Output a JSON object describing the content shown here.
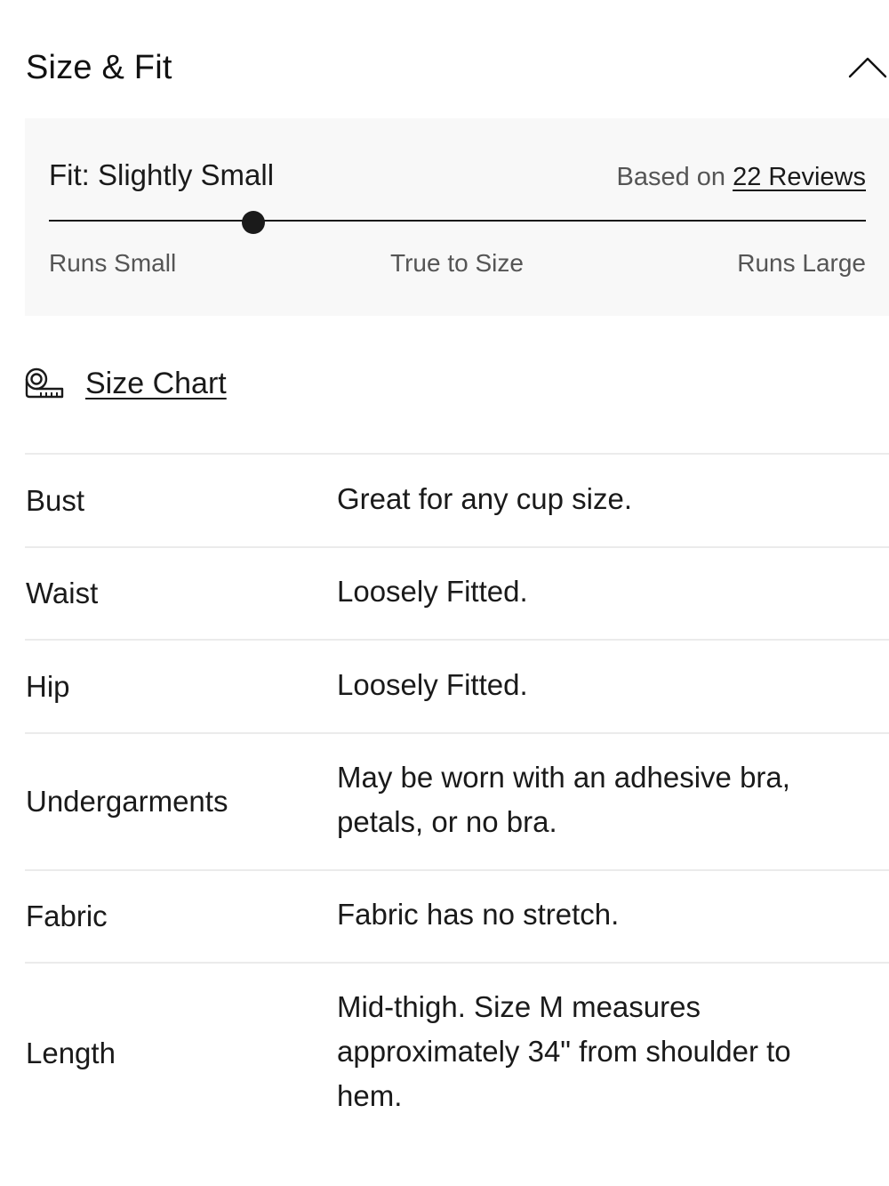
{
  "header": {
    "title": "Size & Fit",
    "collapse_icon": "chevron-up-icon"
  },
  "fit": {
    "label": "Fit: Slightly Small",
    "reviews_prefix": "Based on",
    "reviews_link": "22 Reviews",
    "slider_position": 0.25,
    "scale": {
      "left": "Runs Small",
      "middle": "True to Size",
      "right": "Runs Large"
    }
  },
  "size_chart": {
    "icon": "measuring-tape-icon",
    "label": "Size Chart"
  },
  "specs": [
    {
      "name": "Bust",
      "value": "Great for any cup size."
    },
    {
      "name": "Waist",
      "value": "Loosely Fitted."
    },
    {
      "name": "Hip",
      "value": "Loosely Fitted."
    },
    {
      "name": "Undergarments",
      "value": "May be worn with an adhesive bra, petals, or no bra."
    },
    {
      "name": "Fabric",
      "value": "Fabric has no stretch."
    },
    {
      "name": "Length",
      "value": "Mid-thigh. Size M measures approximately 34\" from shoulder to hem."
    }
  ]
}
